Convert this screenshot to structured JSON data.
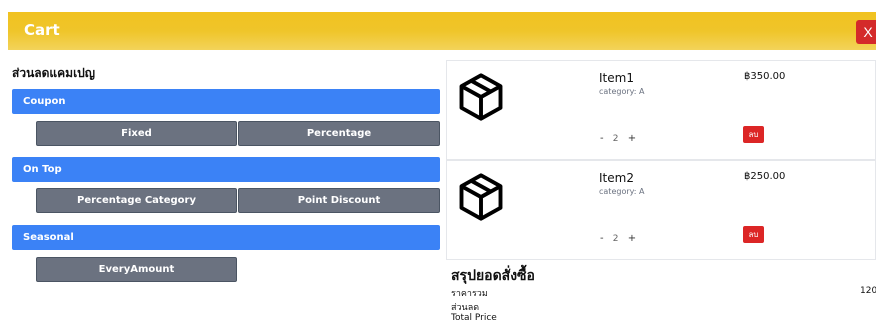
{
  "header": {
    "title": "Cart",
    "close_label": "X"
  },
  "campaign": {
    "title": "ส่วนลดแคมเปญ",
    "groups": [
      {
        "label": "Coupon",
        "options": [
          "Fixed",
          "Percentage"
        ]
      },
      {
        "label": "On Top",
        "options": [
          "Percentage Category",
          "Point Discount"
        ]
      },
      {
        "label": "Seasonal",
        "options": [
          "EveryAmount"
        ]
      }
    ]
  },
  "cart": {
    "items": [
      {
        "name": "Item1",
        "category": "category: A",
        "price": "฿350.00",
        "qty_minus": "-",
        "qty": "2",
        "qty_plus": "+",
        "delete_label": "ลบ",
        "icon": "box-icon"
      },
      {
        "name": "Item2",
        "category": "category: A",
        "price": "฿250.00",
        "qty_minus": "-",
        "qty": "2",
        "qty_plus": "+",
        "delete_label": "ลบ",
        "icon": "box-icon"
      }
    ]
  },
  "summary": {
    "title": "สรุปยอดสั่งซื้อ",
    "subtotal_label": "ราคารวม",
    "subtotal_value": "120",
    "discount_label": "ส่วนลด",
    "total_label": "Total Price"
  }
}
